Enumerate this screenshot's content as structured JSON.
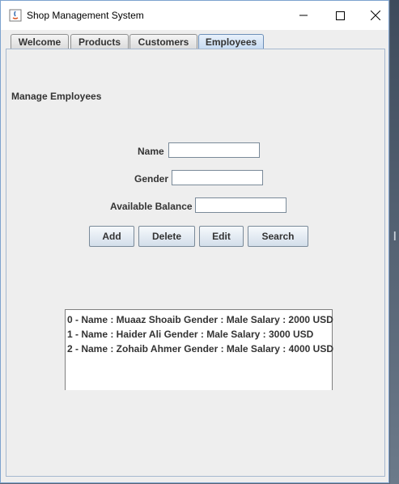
{
  "window": {
    "title": "Shop Management System",
    "controls": [
      "minimize",
      "maximize",
      "close"
    ]
  },
  "tabs": [
    {
      "label": "Welcome",
      "active": false
    },
    {
      "label": "Products",
      "active": false
    },
    {
      "label": "Customers",
      "active": false
    },
    {
      "label": "Employees",
      "active": true
    }
  ],
  "panel": {
    "heading": "Manage Employees",
    "form": {
      "name_label": "Name",
      "name_value": "",
      "gender_label": "Gender",
      "gender_value": "",
      "balance_label": "Available Balance",
      "balance_value": ""
    },
    "buttons": {
      "add": "Add",
      "delete": "Delete",
      "edit": "Edit",
      "search": "Search"
    },
    "employees": [
      "0 -  Name : Muaaz Shoaib Gender : Male Salary : 2000 USD",
      "1 -  Name : Haider Ali Gender : Male Salary : 3000 USD",
      "2 -  Name : Zohaib Ahmer Gender : Male Salary : 4000 USD"
    ]
  },
  "colors": {
    "active_tab": "#c5daf2",
    "window_border": "#7da2ce",
    "panel_bg": "#eeeeee"
  }
}
